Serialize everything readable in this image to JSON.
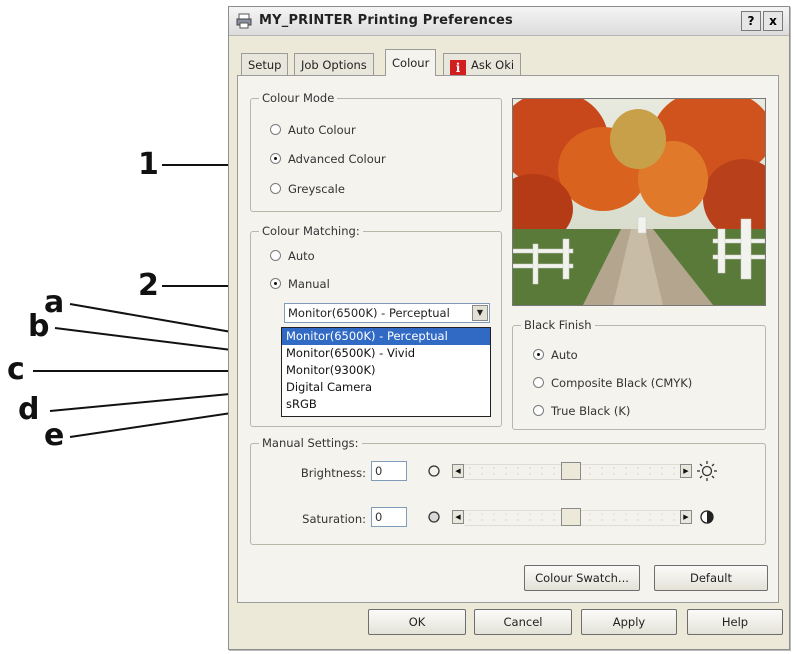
{
  "window": {
    "title": "MY_PRINTER Printing Preferences",
    "help_button": "?",
    "close_button": "x"
  },
  "tabs": [
    {
      "label": "Setup",
      "active": false
    },
    {
      "label": "Job Options",
      "active": false
    },
    {
      "label": "Colour",
      "active": true
    },
    {
      "label": "Ask Oki",
      "active": false,
      "icon": "info-icon"
    }
  ],
  "colour_mode": {
    "title": "Colour Mode",
    "options": [
      {
        "label": "Auto Colour",
        "selected": false
      },
      {
        "label": "Advanced Colour",
        "selected": true
      },
      {
        "label": "Greyscale",
        "selected": false
      }
    ]
  },
  "colour_matching": {
    "title": "Colour Matching:",
    "options": [
      {
        "label": "Auto",
        "selected": false
      },
      {
        "label": "Manual",
        "selected": true
      }
    ],
    "select_value": "Monitor(6500K) - Perceptual",
    "dropdown_items": [
      "Monitor(6500K) - Perceptual",
      "Monitor(6500K) - Vivid",
      "Monitor(9300K)",
      "Digital Camera",
      "sRGB"
    ],
    "dropdown_selected_index": 0
  },
  "black_finish": {
    "title": "Black Finish",
    "options": [
      {
        "label": "Auto",
        "selected": true
      },
      {
        "label": "Composite Black (CMYK)",
        "selected": false
      },
      {
        "label": "True Black (K)",
        "selected": false
      }
    ]
  },
  "manual_settings": {
    "title": "Manual Settings:",
    "brightness_label": "Brightness:",
    "brightness_value": "0",
    "saturation_label": "Saturation:",
    "saturation_value": "0"
  },
  "buttons": {
    "colour_swatch": "Colour Swatch...",
    "default": "Default",
    "ok": "OK",
    "cancel": "Cancel",
    "apply": "Apply",
    "help": "Help"
  },
  "callouts": {
    "one": "1",
    "two": "2",
    "a": "a",
    "b": "b",
    "c": "c",
    "d": "d",
    "e": "e"
  },
  "colors": {
    "dialog_bg": "#ece9d8",
    "selection": "#316ac5",
    "info_icon": "#d11f1f"
  }
}
